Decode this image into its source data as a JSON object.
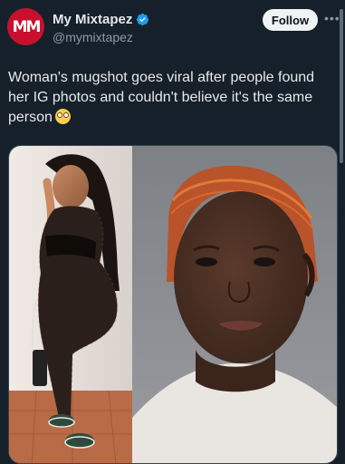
{
  "author": {
    "avatar_text": "MM",
    "display_name": "My Mixtapez",
    "handle": "@mymixtapez",
    "verified": true
  },
  "actions": {
    "follow_label": "Follow",
    "more_icon": "more-icon"
  },
  "tweet": {
    "text": "Woman's mugshot goes viral after people found her IG photos and couldn't believe it's the same person",
    "emoji": "flushed-face-emoji"
  },
  "colors": {
    "background": "#15202b",
    "text": "#e7e9ea",
    "secondary": "#8b98a5",
    "verified": "#1d9bf0",
    "avatar": "#c8102e"
  }
}
